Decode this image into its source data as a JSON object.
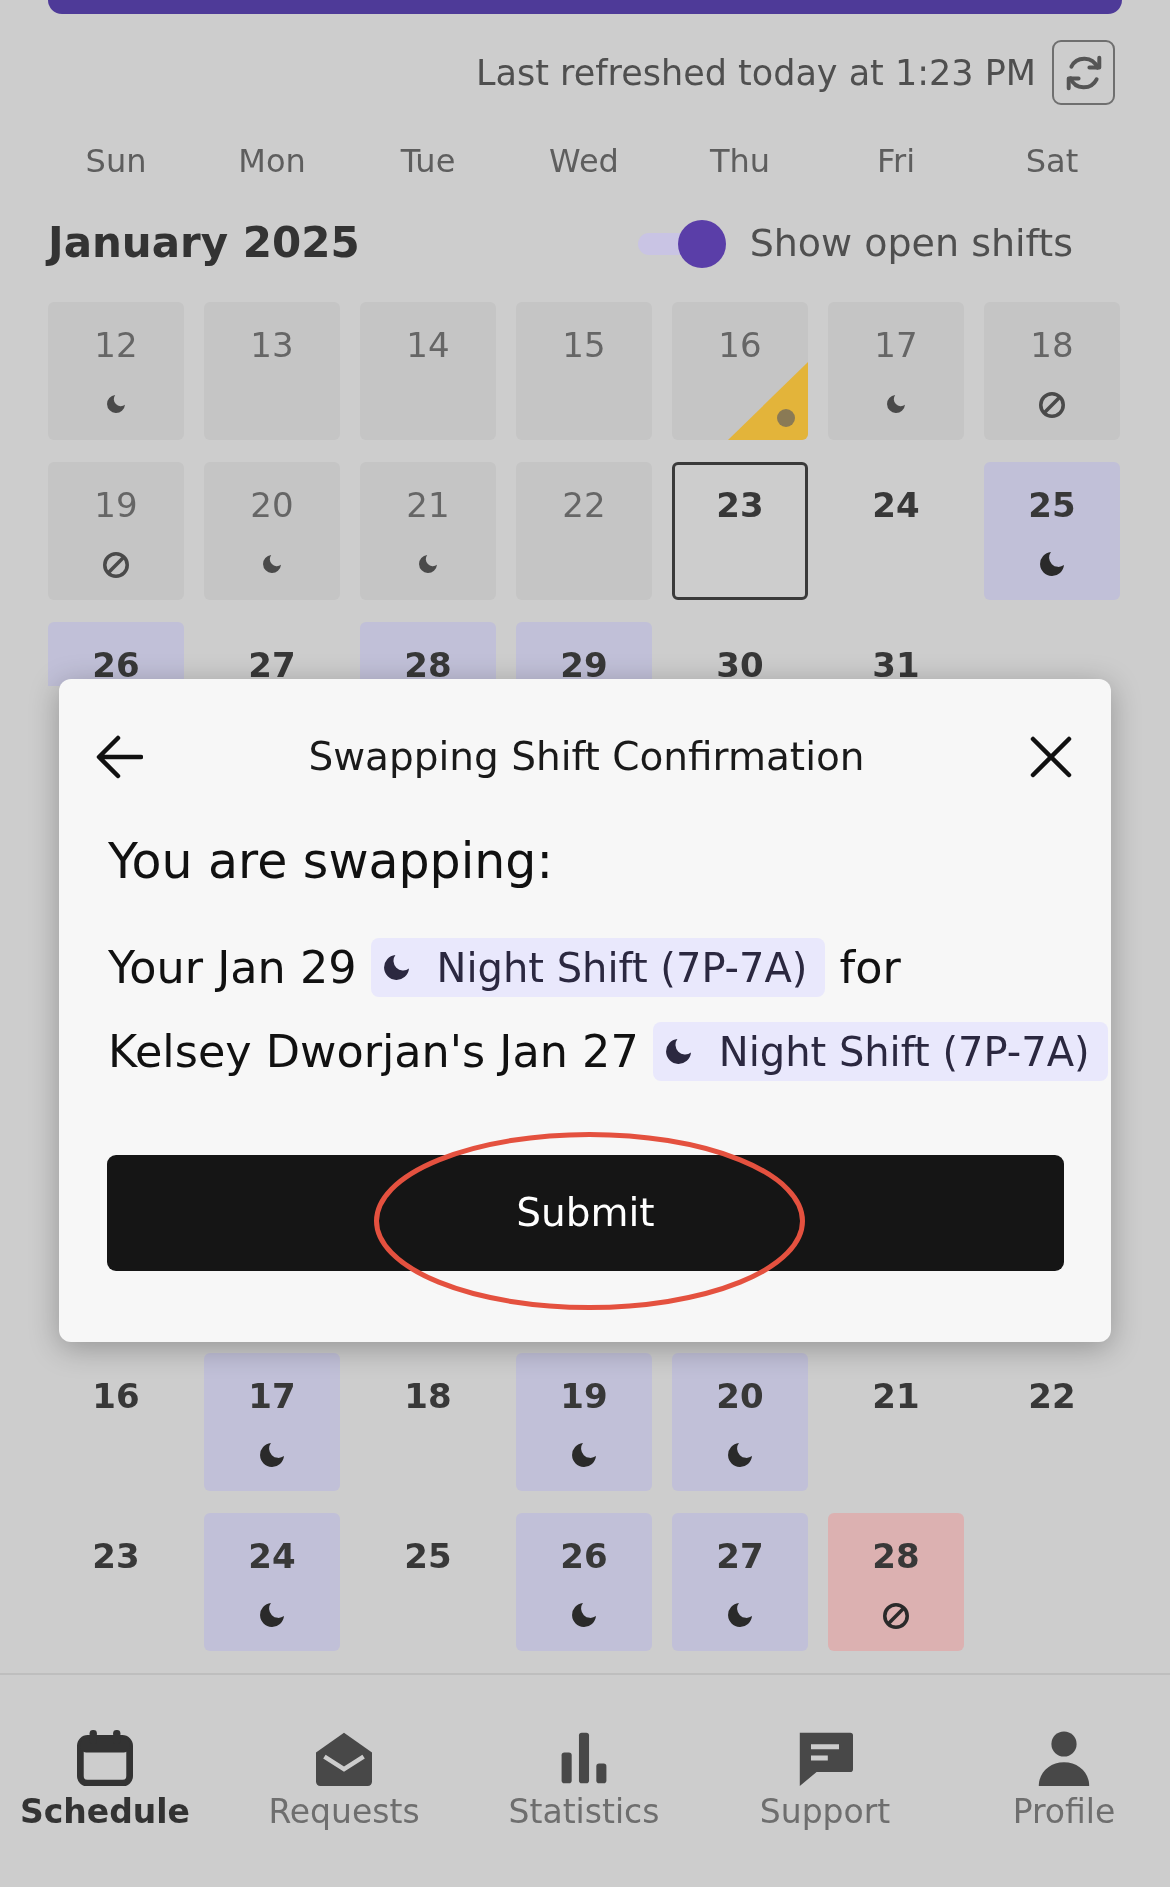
{
  "top_bar": {
    "refresh_text": "Last refreshed today at 1:23 PM"
  },
  "weekdays": [
    "Sun",
    "Mon",
    "Tue",
    "Wed",
    "Thu",
    "Fri",
    "Sat"
  ],
  "months": [
    {
      "title": "January 2025",
      "open_shifts": {
        "label": "Show open shifts",
        "on": true
      },
      "weeks": [
        [
          {
            "day": "12",
            "past": true,
            "today": false,
            "marker": {
              "kind": "night"
            },
            "flagged": false
          },
          {
            "day": "13",
            "past": true,
            "today": false,
            "flagged": false
          },
          {
            "day": "14",
            "past": true,
            "today": false,
            "flagged": false
          },
          {
            "day": "15",
            "past": true,
            "today": false,
            "flagged": false
          },
          {
            "day": "16",
            "past": true,
            "today": false,
            "flagged": true
          },
          {
            "day": "17",
            "past": true,
            "today": false,
            "marker": {
              "kind": "night"
            },
            "flagged": false
          },
          {
            "day": "18",
            "past": true,
            "today": false,
            "marker": {
              "kind": "off"
            },
            "flagged": false
          }
        ],
        [
          {
            "day": "19",
            "past": true,
            "today": false,
            "marker": {
              "kind": "off"
            },
            "flagged": false
          },
          {
            "day": "20",
            "past": true,
            "today": false,
            "marker": {
              "kind": "night"
            },
            "flagged": false
          },
          {
            "day": "21",
            "past": true,
            "today": false,
            "marker": {
              "kind": "night"
            },
            "flagged": false
          },
          {
            "day": "22",
            "past": true,
            "today": false,
            "flagged": false
          },
          {
            "day": "23",
            "past": false,
            "today": true,
            "flagged": false
          },
          {
            "day": "24",
            "past": false,
            "today": false,
            "flagged": false
          },
          {
            "day": "25",
            "past": false,
            "today": false,
            "marker": {
              "kind": "night"
            },
            "color": "#c1c0d8",
            "flagged": false
          }
        ],
        [
          {
            "day": "26",
            "past": false,
            "today": false,
            "color": "#c1c0d8",
            "flagged": false
          },
          {
            "day": "27",
            "past": false,
            "today": false,
            "flagged": false
          },
          {
            "day": "28",
            "past": false,
            "today": false,
            "color": "#c1c0d8",
            "flagged": false
          },
          {
            "day": "29",
            "past": false,
            "today": false,
            "color": "#c1c0d8",
            "flagged": false
          },
          {
            "day": "30",
            "past": false,
            "today": false,
            "flagged": false
          },
          {
            "day": "31",
            "past": false,
            "today": false,
            "flagged": false
          }
        ]
      ]
    },
    {
      "weeks": [
        [
          {
            "day": "16",
            "past": false,
            "today": false,
            "flagged": false
          },
          {
            "day": "17",
            "past": false,
            "today": false,
            "marker": {
              "kind": "night"
            },
            "color": "#c1c0d8",
            "flagged": false
          },
          {
            "day": "18",
            "past": false,
            "today": false,
            "flagged": false
          },
          {
            "day": "19",
            "past": false,
            "today": false,
            "marker": {
              "kind": "night"
            },
            "color": "#c1c0d8",
            "flagged": false
          },
          {
            "day": "20",
            "past": false,
            "today": false,
            "marker": {
              "kind": "night"
            },
            "color": "#c1c0d8",
            "flagged": false
          },
          {
            "day": "21",
            "past": false,
            "today": false,
            "flagged": false
          },
          {
            "day": "22",
            "past": false,
            "today": false,
            "flagged": false
          }
        ],
        [
          {
            "day": "23",
            "past": false,
            "today": false,
            "flagged": false
          },
          {
            "day": "24",
            "past": false,
            "today": false,
            "marker": {
              "kind": "night"
            },
            "color": "#c1c0d8",
            "flagged": false
          },
          {
            "day": "25",
            "past": false,
            "today": false,
            "flagged": false
          },
          {
            "day": "26",
            "past": false,
            "today": false,
            "marker": {
              "kind": "night"
            },
            "color": "#c1c0d8",
            "flagged": false
          },
          {
            "day": "27",
            "past": false,
            "today": false,
            "marker": {
              "kind": "night"
            },
            "color": "#c1c0d8",
            "flagged": false
          },
          {
            "day": "28",
            "past": false,
            "today": false,
            "marker": {
              "kind": "off"
            },
            "color": "#dcb1b1",
            "flagged": false
          }
        ]
      ]
    }
  ],
  "dialog": {
    "title": "Swapping Shift Confirmation",
    "heading": "You are swapping:",
    "swaps": [
      {
        "text": "Your Jan 29",
        "shift": {
          "kind": "night",
          "label": "Night Shift (7P-7A)"
        },
        "after": "for"
      },
      {
        "text": "Kelsey Dworjan's Jan 27",
        "shift": {
          "kind": "night",
          "label": "Night Shift (7P-7A)"
        }
      }
    ],
    "submit": {
      "label": "Submit",
      "circled": true
    }
  },
  "nav": [
    {
      "label": "Schedule",
      "selected": true
    },
    {
      "label": "Requests",
      "selected": false
    },
    {
      "label": "Statistics",
      "selected": false
    },
    {
      "label": "Support",
      "selected": false
    },
    {
      "label": "Profile",
      "selected": false
    }
  ]
}
